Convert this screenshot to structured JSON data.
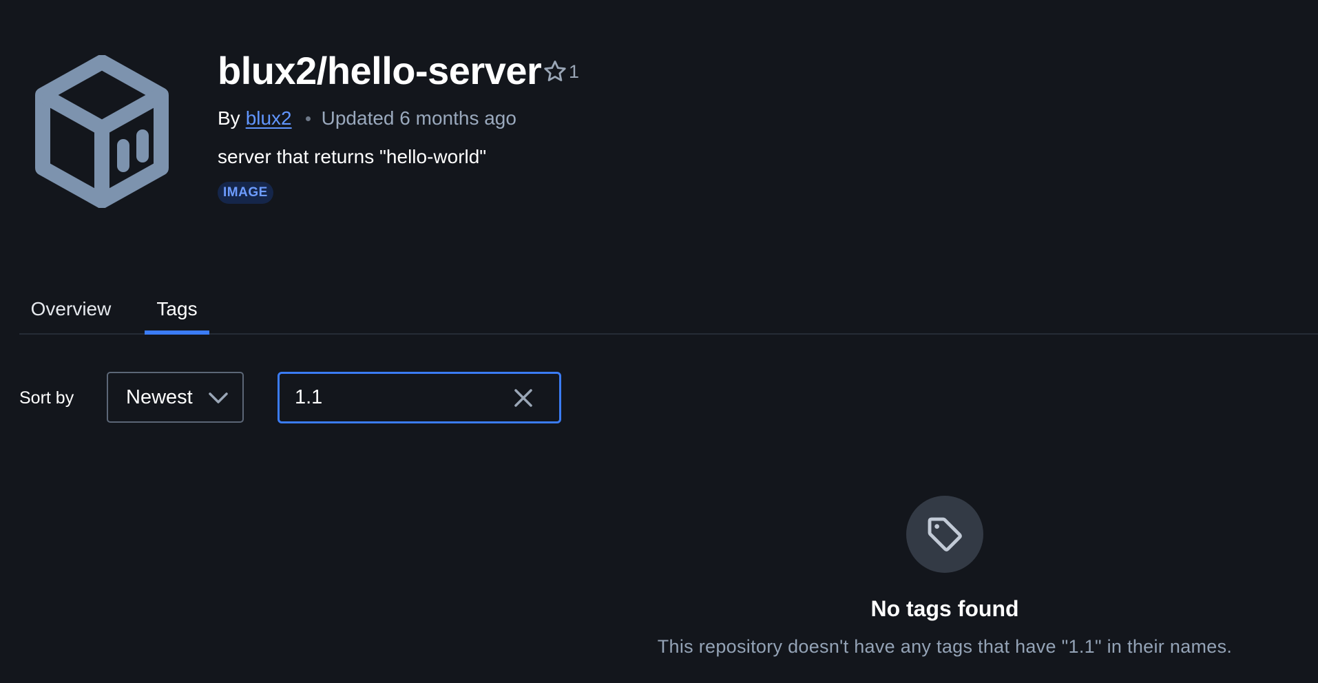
{
  "repo": {
    "title": "blux2/hello-server",
    "star_count": "1",
    "by_label": "By",
    "author": "blux2",
    "updated": "Updated 6 months ago",
    "description": "server that returns \"hello-world\"",
    "badge": "IMAGE"
  },
  "tabs": [
    {
      "label": "Overview",
      "active": false
    },
    {
      "label": "Tags",
      "active": true
    }
  ],
  "controls": {
    "sort_label": "Sort by",
    "sort_value": "Newest",
    "filter_value": "1.1"
  },
  "empty_state": {
    "title": "No tags found",
    "message": "This repository doesn't have any tags that have \"1.1\" in their names."
  },
  "colors": {
    "background": "#13161c",
    "accent": "#3b7cf5",
    "link": "#6196ff",
    "badge_bg": "#15264a",
    "logo": "#7d93ae"
  },
  "icons": {
    "logo": "cube-icon",
    "star": "star-icon",
    "sort": "chevron-down-icon",
    "clear": "close-icon",
    "empty": "tag-icon"
  }
}
